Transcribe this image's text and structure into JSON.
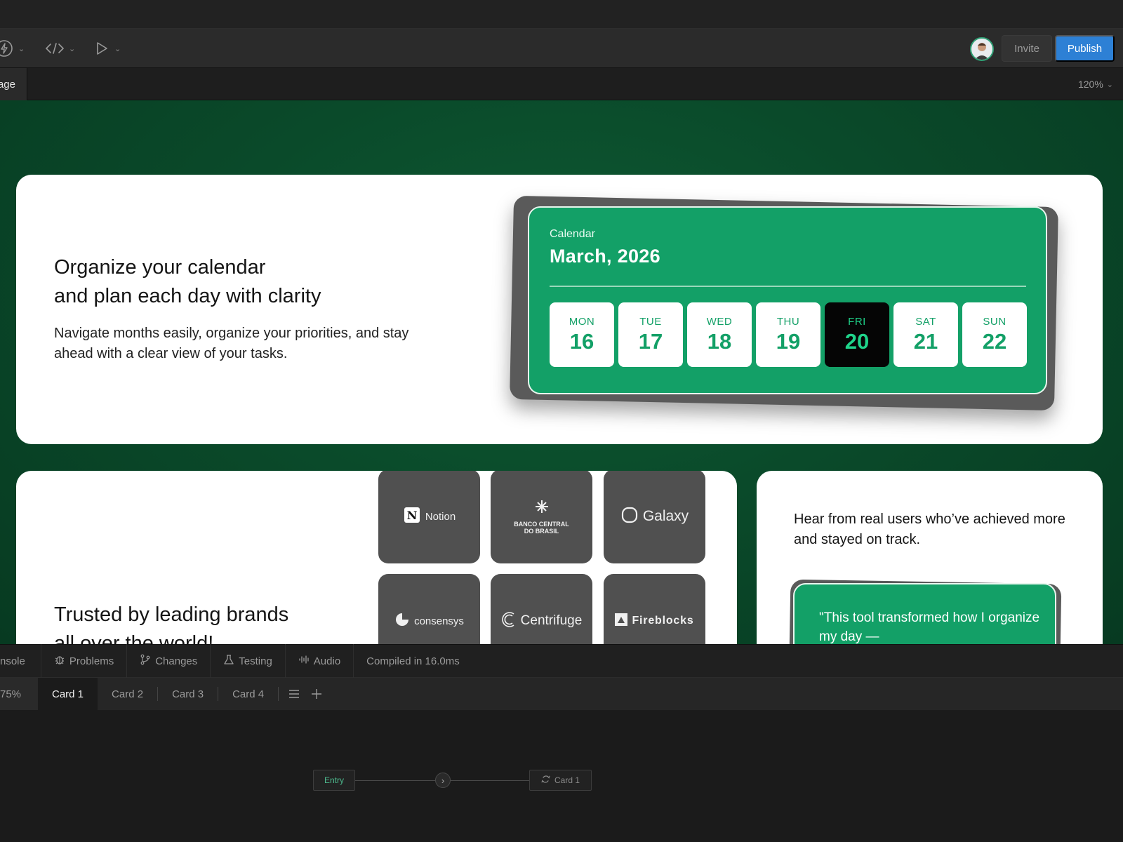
{
  "toolbar": {
    "invite_label": "Invite",
    "publish_label": "Publish",
    "publish_color": "#2d80d5"
  },
  "pagebar": {
    "page_tab_label": "age",
    "zoom_label": "120%"
  },
  "canvas": {
    "background_color": "#0a4a2a",
    "hero": {
      "title_line1": "Organize your calendar",
      "title_line2": "and plan each day with clarity",
      "description": "Navigate months easily, organize your priorities, and stay ahead with a clear view of your tasks."
    },
    "calendar": {
      "label": "Calendar",
      "month": "March, 2026",
      "accent_color": "#13a067",
      "days": [
        {
          "name": "MON",
          "date": "16"
        },
        {
          "name": "TUE",
          "date": "17"
        },
        {
          "name": "WED",
          "date": "18"
        },
        {
          "name": "THU",
          "date": "19"
        },
        {
          "name": "FRI",
          "date": "20"
        },
        {
          "name": "SAT",
          "date": "21"
        },
        {
          "name": "SUN",
          "date": "22"
        }
      ],
      "selected_day": "FRI"
    },
    "brands": {
      "title_line1": "Trusted by leading brands",
      "title_line2": "all over the world!",
      "logos": [
        {
          "name": "Notion",
          "icon": "notion-logo-icon"
        },
        {
          "name": "BANCO CENTRAL DO BRASIL",
          "icon": "banco-central-logo-icon"
        },
        {
          "name": "Galaxy",
          "icon": "galaxy-logo-icon"
        },
        {
          "name": "consensys",
          "icon": "consensys-logo-icon"
        },
        {
          "name": "Centrifuge",
          "icon": "centrifuge-logo-icon"
        },
        {
          "name": "Fireblocks",
          "icon": "fireblocks-logo-icon"
        }
      ]
    },
    "testimonials": {
      "intro": "Hear from real users who’ve achieved more and stayed on track.",
      "quote": "\"This tool transformed how I organize my day —"
    }
  },
  "statusbar": {
    "tabs": [
      {
        "label": "nsole",
        "icon": ""
      },
      {
        "label": "Problems",
        "icon": "bug-icon"
      },
      {
        "label": "Changes",
        "icon": "branch-icon"
      },
      {
        "label": "Testing",
        "icon": "flask-icon"
      },
      {
        "label": "Audio",
        "icon": "waveform-icon"
      }
    ],
    "compiled": "Compiled in 16.0ms"
  },
  "cardbar": {
    "zoom_label": "75%",
    "tabs": [
      "Card 1",
      "Card 2",
      "Card 3",
      "Card 4"
    ],
    "active_tab": "Card 1"
  },
  "flow": {
    "entry_label": "Entry",
    "card_label": "Card 1"
  }
}
